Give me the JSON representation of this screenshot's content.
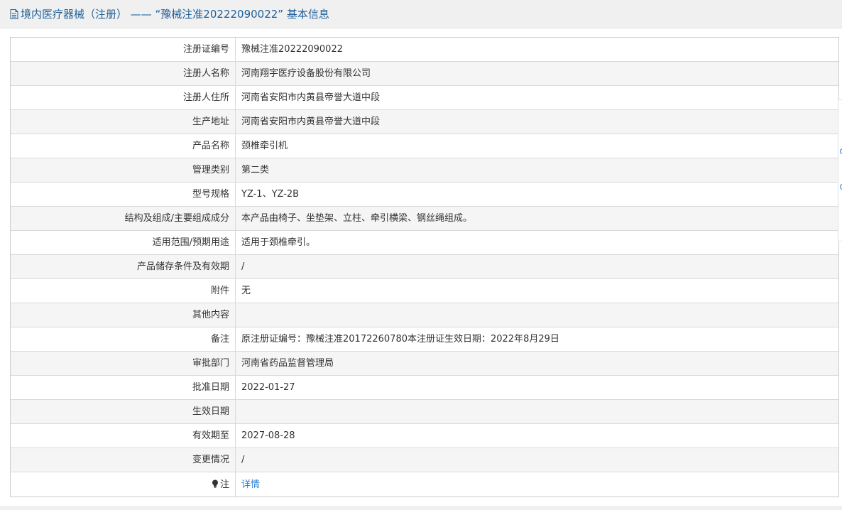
{
  "header": {
    "title": "境内医疗器械（注册） —— “豫械注准20222090022” 基本信息"
  },
  "rows": [
    {
      "label": "注册证编号",
      "value": "豫械注准20222090022"
    },
    {
      "label": "注册人名称",
      "value": "河南翔宇医疗设备股份有限公司"
    },
    {
      "label": "注册人住所",
      "value": "河南省安阳市内黄县帝誉大道中段"
    },
    {
      "label": "生产地址",
      "value": "河南省安阳市内黄县帝誉大道中段"
    },
    {
      "label": "产品名称",
      "value": "颈椎牵引机"
    },
    {
      "label": "管理类别",
      "value": "第二类"
    },
    {
      "label": "型号规格",
      "value": "YZ-1、YZ-2B"
    },
    {
      "label": "结构及组成/主要组成成分",
      "value": "本产品由椅子、坐垫架、立柱、牵引横梁、钢丝绳组成。"
    },
    {
      "label": "适用范围/预期用途",
      "value": "适用于颈椎牵引。"
    },
    {
      "label": "产品储存条件及有效期",
      "value": "/"
    },
    {
      "label": "附件",
      "value": "无"
    },
    {
      "label": "其他内容",
      "value": ""
    },
    {
      "label": "备注",
      "value": "原注册证编号：豫械注准20172260780本注册证生效日期：2022年8月29日"
    },
    {
      "label": "审批部门",
      "value": "河南省药品监督管理局"
    },
    {
      "label": "批准日期",
      "value": "2022-01-27"
    },
    {
      "label": "生效日期",
      "value": ""
    },
    {
      "label": "有效期至",
      "value": "2027-08-28"
    },
    {
      "label": "变更情况",
      "value": "/"
    }
  ],
  "note_row": {
    "label": "注",
    "link_text": "详情"
  },
  "colors": {
    "header_text": "#1f5f9a",
    "link": "#2a7ec8",
    "row_alt": "#f5f5f5"
  }
}
